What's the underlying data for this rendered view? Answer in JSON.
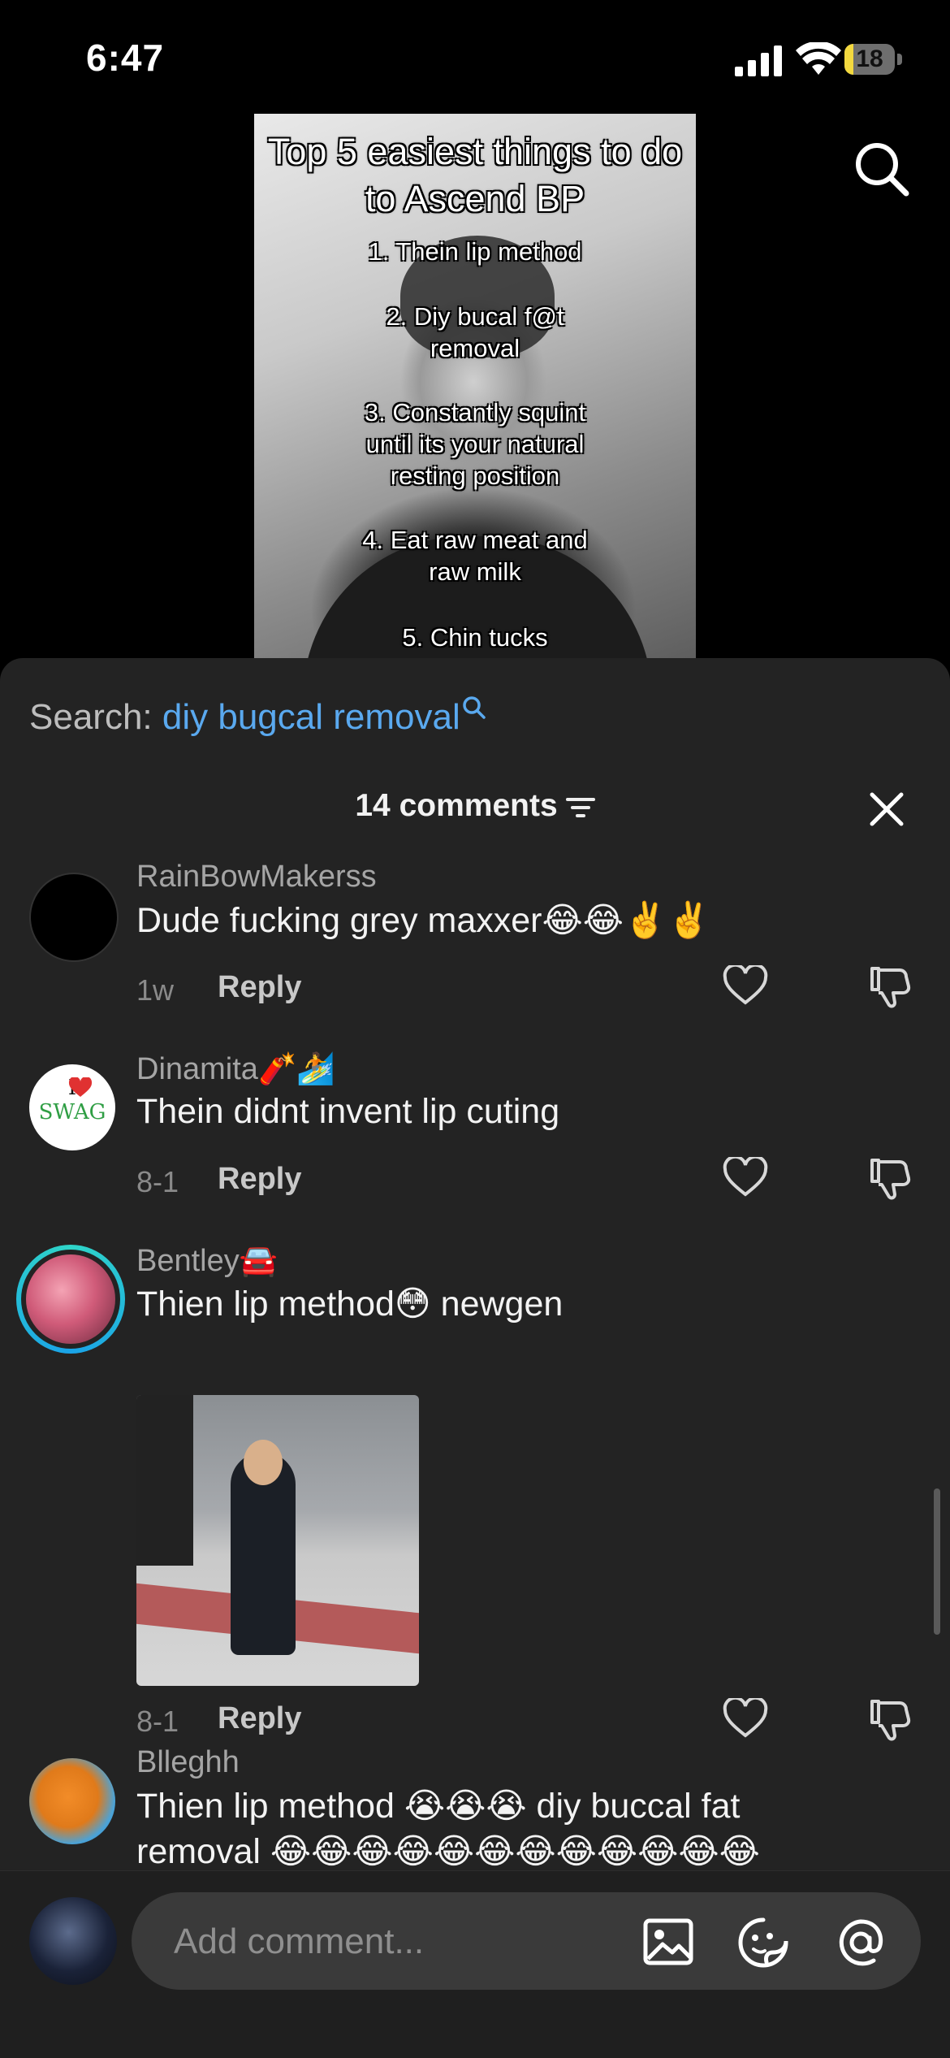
{
  "status_bar": {
    "time": "6:47",
    "battery": "18",
    "battery_level": 0.18
  },
  "video": {
    "title": "Top 5 easiest things to do to Ascend BP",
    "lines": [
      "1. Thein lip method",
      "2. Diy bucal f@t removal",
      "3. Constantly squint until its your natural resting position",
      "4. Eat raw meat and raw milk",
      "5. Chin tucks"
    ]
  },
  "search": {
    "label": "Search:",
    "query": "diy bugcal removal"
  },
  "comments_header": {
    "count_label": "14 comments"
  },
  "comments": [
    {
      "username": "RainBowMakerss",
      "text": "Dude fucking grey maxxer😂😂✌️✌️",
      "time": "1w",
      "reply": "Reply"
    },
    {
      "username": "Dinamita🧨🏄",
      "text": "Thein didnt invent lip cuting",
      "time": "8-1",
      "reply": "Reply"
    },
    {
      "username": "Bentley🚘",
      "text": "Thien lip method😳 newgen",
      "time": "8-1",
      "reply": "Reply"
    },
    {
      "username": "Blleghh",
      "text": "Thien lip method 😭😭😭 diy buccal fat",
      "text2": "removal 😂😂😂😂😂😂😂😂😂😂😂😂"
    }
  ],
  "avatar_text": {
    "dinamita_top": "I",
    "dinamita_bottom": "SWAG"
  },
  "input": {
    "placeholder": "Add comment..."
  },
  "colors": {
    "accent": "#5aa9ef",
    "sheet_bg": "#232323",
    "story_ring": "#2fd5c8"
  },
  "icons": [
    "search-icon",
    "filter-icon",
    "close-icon",
    "heart-icon",
    "dislike-icon",
    "image-icon",
    "sticker-icon",
    "mention-icon"
  ]
}
